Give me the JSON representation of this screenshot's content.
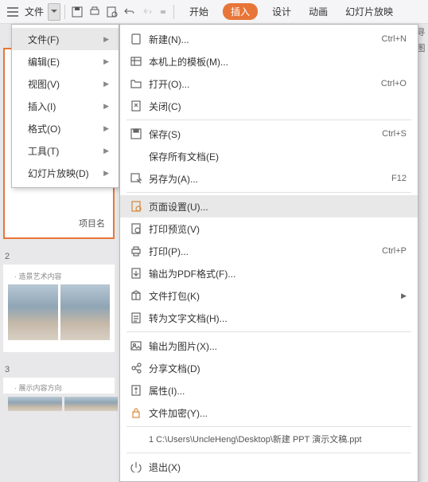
{
  "toolbar": {
    "file_label": "文件",
    "tabs": [
      "开始",
      "插入",
      "设计",
      "动画",
      "幻灯片放映"
    ],
    "active_tab_index": 1
  },
  "right_icons": [
    "寻",
    "图"
  ],
  "main_menu": {
    "items": [
      {
        "label": "文件(F)",
        "arrow": true,
        "hl": true
      },
      {
        "label": "编辑(E)",
        "arrow": true
      },
      {
        "label": "视图(V)",
        "arrow": true
      },
      {
        "label": "插入(I)",
        "arrow": true
      },
      {
        "label": "格式(O)",
        "arrow": true
      },
      {
        "label": "工具(T)",
        "arrow": true
      },
      {
        "label": "幻灯片放映(D)",
        "arrow": true
      }
    ]
  },
  "sub_menu": {
    "items": [
      {
        "icon": "new",
        "label": "新建(N)...",
        "shortcut": "Ctrl+N"
      },
      {
        "icon": "template",
        "label": "本机上的模板(M)..."
      },
      {
        "icon": "open",
        "label": "打开(O)...",
        "shortcut": "Ctrl+O"
      },
      {
        "icon": "close",
        "label": "关闭(C)"
      },
      {
        "sep": true
      },
      {
        "icon": "save",
        "label": "保存(S)",
        "shortcut": "Ctrl+S"
      },
      {
        "icon": "",
        "label": "保存所有文档(E)"
      },
      {
        "icon": "saveas",
        "label": "另存为(A)...",
        "shortcut": "F12"
      },
      {
        "sep": true
      },
      {
        "icon": "pagesetup",
        "label": "页面设置(U)...",
        "hl": true
      },
      {
        "icon": "preview",
        "label": "打印预览(V)"
      },
      {
        "icon": "print",
        "label": "打印(P)...",
        "shortcut": "Ctrl+P"
      },
      {
        "icon": "pdf",
        "label": "输出为PDF格式(F)..."
      },
      {
        "icon": "package",
        "label": "文件打包(K)",
        "arrow": true
      },
      {
        "icon": "word",
        "label": "转为文字文档(H)..."
      },
      {
        "sep": true
      },
      {
        "icon": "image",
        "label": "输出为图片(X)..."
      },
      {
        "icon": "share",
        "label": "分享文档(D)"
      },
      {
        "icon": "props",
        "label": "属性(I)..."
      },
      {
        "icon": "encrypt",
        "label": "文件加密(Y)..."
      },
      {
        "sep": true
      },
      {
        "recent": "1 C:\\Users\\UncleHeng\\Desktop\\新建 PPT 演示文稿.ppt"
      },
      {
        "sep": true
      },
      {
        "icon": "exit",
        "label": "退出(X)"
      }
    ]
  },
  "thumbs": {
    "label1": "项目名",
    "num2": "2",
    "title2": "· 造景艺术内容",
    "num3": "3",
    "title3": "· 展示内容方向"
  }
}
